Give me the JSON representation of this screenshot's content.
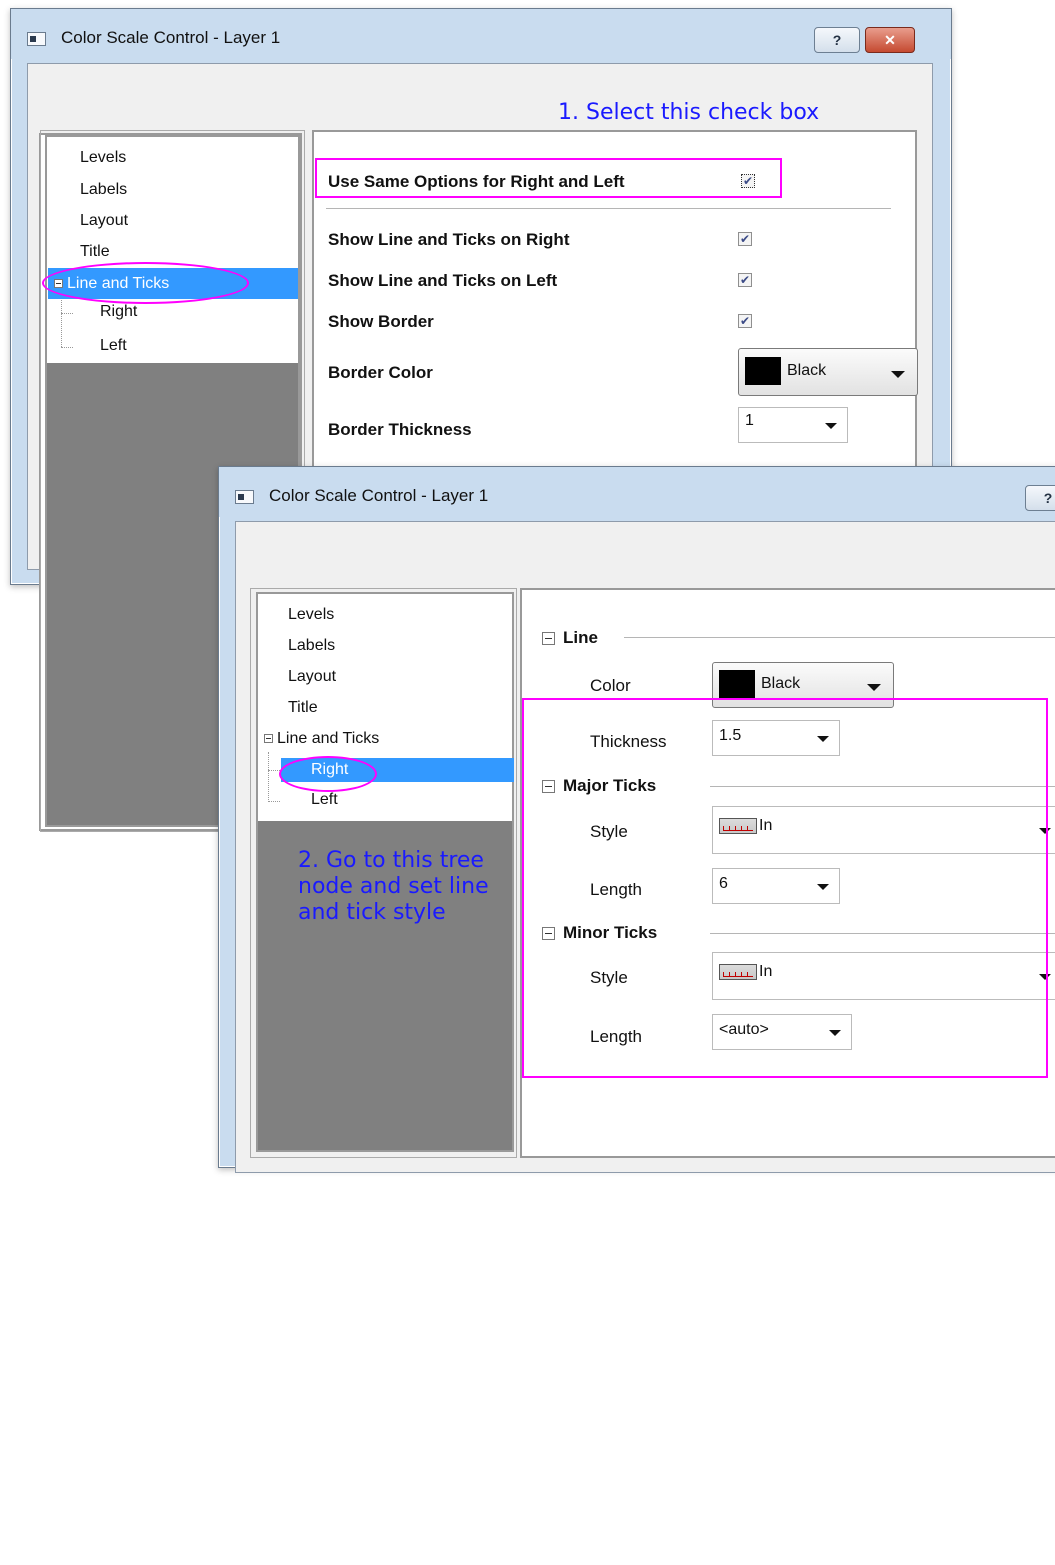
{
  "dialog_back": {
    "title": "Color Scale Control - Layer 1",
    "help_button": "?",
    "close_button": "✕",
    "tree": [
      "Levels",
      "Labels",
      "Layout",
      "Title",
      "Line and Ticks",
      "Right",
      "Left"
    ],
    "use_same_label": "Use Same Options for Right and Left",
    "use_same_checked": true,
    "options": [
      {
        "label": "Show Line and Ticks on Right",
        "checked": true
      },
      {
        "label": "Show Line and Ticks on Left",
        "checked": true
      },
      {
        "label": "Show Border",
        "checked": true
      }
    ],
    "border_color_label": "Border Color",
    "border_color_value": "Black",
    "border_thickness_label": "Border Thickness",
    "border_thickness_value": "1"
  },
  "dialog_front": {
    "title": "Color Scale Control - Layer 1",
    "help_button": "?",
    "tree": [
      "Levels",
      "Labels",
      "Layout",
      "Title",
      "Line and Ticks",
      "Right",
      "Left"
    ],
    "line_group": "Line",
    "color_label": "Color",
    "color_value": "Black",
    "thickness_label": "Thickness",
    "thickness_value": "1.5",
    "major_group": "Major Ticks",
    "major_style_label": "Style",
    "major_style_value": "In",
    "major_length_label": "Length",
    "major_length_value": "6",
    "minor_group": "Minor Ticks",
    "minor_style_label": "Style",
    "minor_style_value": "In",
    "minor_length_label": "Length",
    "minor_length_value": "<auto>"
  },
  "annotations": {
    "step1": "1. Select this check box",
    "step2": "2. Go to this tree node and set line and tick style"
  },
  "colors": {
    "highlight": "#ff00ff",
    "annotation": "#1a1aff",
    "selection": "#3399ff",
    "swatch": "#000000"
  },
  "icons": [
    "app-icon",
    "help-icon",
    "close-icon",
    "collapse-icon",
    "checkmark-icon",
    "chevron-down-icon",
    "tick-style-icon"
  ]
}
